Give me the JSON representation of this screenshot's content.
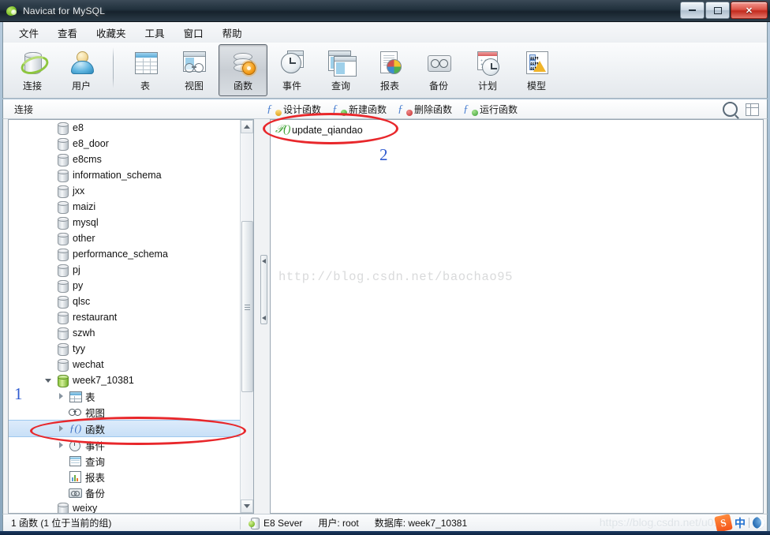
{
  "window": {
    "title": "Navicat for MySQL",
    "app_icon": "navicat-leaf-icon",
    "minimize_label": "—",
    "maximize_label": "❐",
    "close_label": "✕"
  },
  "menubar": {
    "items": [
      {
        "label": "文件",
        "name": "menu-file"
      },
      {
        "label": "查看",
        "name": "menu-view"
      },
      {
        "label": "收藏夹",
        "name": "menu-favorites"
      },
      {
        "label": "工具",
        "name": "menu-tools"
      },
      {
        "label": "窗口",
        "name": "menu-window"
      },
      {
        "label": "帮助",
        "name": "menu-help"
      }
    ]
  },
  "toolbar": {
    "items": [
      {
        "label": "连接",
        "icon": "connection-icon",
        "selected": false
      },
      {
        "label": "用户",
        "icon": "user-icon",
        "selected": false
      },
      {
        "label": "表",
        "icon": "table-icon",
        "selected": false
      },
      {
        "label": "视图",
        "icon": "view-icon",
        "selected": false
      },
      {
        "label": "函数",
        "icon": "function-icon",
        "selected": true
      },
      {
        "label": "事件",
        "icon": "event-icon",
        "selected": false
      },
      {
        "label": "查询",
        "icon": "query-icon",
        "selected": false
      },
      {
        "label": "报表",
        "icon": "report-icon",
        "selected": false
      },
      {
        "label": "备份",
        "icon": "backup-icon",
        "selected": false
      },
      {
        "label": "计划",
        "icon": "schedule-icon",
        "selected": false
      },
      {
        "label": "模型",
        "icon": "model-icon",
        "selected": false
      }
    ]
  },
  "subtoolbar": {
    "panel_title": "连接",
    "actions": [
      {
        "label": "设计函数",
        "icon": "design-function-icon"
      },
      {
        "label": "新建函数",
        "icon": "new-function-icon"
      },
      {
        "label": "删除函数",
        "icon": "delete-function-icon"
      },
      {
        "label": "运行函数",
        "icon": "run-function-icon"
      }
    ],
    "search_icon": "search-icon",
    "view_icon": "grid-view-icon"
  },
  "tree": {
    "items": [
      {
        "label": "e8",
        "icon": "database-icon",
        "level": 1,
        "expander": "none",
        "selected": false
      },
      {
        "label": "e8_door",
        "icon": "database-icon",
        "level": 1,
        "expander": "none",
        "selected": false
      },
      {
        "label": "e8cms",
        "icon": "database-icon",
        "level": 1,
        "expander": "none",
        "selected": false
      },
      {
        "label": "information_schema",
        "icon": "database-icon",
        "level": 1,
        "expander": "none",
        "selected": false
      },
      {
        "label": "jxx",
        "icon": "database-icon",
        "level": 1,
        "expander": "none",
        "selected": false
      },
      {
        "label": "maizi",
        "icon": "database-icon",
        "level": 1,
        "expander": "none",
        "selected": false
      },
      {
        "label": "mysql",
        "icon": "database-icon",
        "level": 1,
        "expander": "none",
        "selected": false
      },
      {
        "label": "other",
        "icon": "database-icon",
        "level": 1,
        "expander": "none",
        "selected": false
      },
      {
        "label": "performance_schema",
        "icon": "database-icon",
        "level": 1,
        "expander": "none",
        "selected": false
      },
      {
        "label": "pj",
        "icon": "database-icon",
        "level": 1,
        "expander": "none",
        "selected": false
      },
      {
        "label": "py",
        "icon": "database-icon",
        "level": 1,
        "expander": "none",
        "selected": false
      },
      {
        "label": "qlsc",
        "icon": "database-icon",
        "level": 1,
        "expander": "none",
        "selected": false
      },
      {
        "label": "restaurant",
        "icon": "database-icon",
        "level": 1,
        "expander": "none",
        "selected": false
      },
      {
        "label": "szwh",
        "icon": "database-icon",
        "level": 1,
        "expander": "none",
        "selected": false
      },
      {
        "label": "tyy",
        "icon": "database-icon",
        "level": 1,
        "expander": "none",
        "selected": false
      },
      {
        "label": "wechat",
        "icon": "database-icon",
        "level": 1,
        "expander": "none",
        "selected": false
      },
      {
        "label": "week7_10381",
        "icon": "database-open-icon",
        "level": 1,
        "expander": "open",
        "selected": false
      },
      {
        "label": "表",
        "icon": "table-node-icon",
        "level": 2,
        "expander": "closed",
        "selected": false
      },
      {
        "label": "视图",
        "icon": "view-node-icon",
        "level": 2,
        "expander": "none",
        "selected": false
      },
      {
        "label": "函数",
        "icon": "function-node-icon",
        "level": 2,
        "expander": "closed",
        "selected": true
      },
      {
        "label": "事件",
        "icon": "event-node-icon",
        "level": 2,
        "expander": "closed",
        "selected": false
      },
      {
        "label": "查询",
        "icon": "query-node-icon",
        "level": 2,
        "expander": "none",
        "selected": false
      },
      {
        "label": "报表",
        "icon": "report-node-icon",
        "level": 2,
        "expander": "none",
        "selected": false
      },
      {
        "label": "备份",
        "icon": "backup-node-icon",
        "level": 2,
        "expander": "none",
        "selected": false
      },
      {
        "label": "weixy",
        "icon": "database-icon",
        "level": 1,
        "expander": "none",
        "selected": false
      }
    ]
  },
  "main": {
    "functions": [
      {
        "name": "update_qiandao",
        "icon": "procedure-icon"
      }
    ],
    "watermark": "http://blog.csdn.net/baochao95"
  },
  "statusbar": {
    "count_text": "1 函数 (1 位于当前的组)",
    "server": "E8 Sever",
    "server_icon": "server-icon",
    "user": "用户: root",
    "database": "数据库: week7_10381"
  },
  "overlay": {
    "watermark": "https://blog.csdn.net/u01...",
    "ime_sogou": "S",
    "ime_mode": "中",
    "ime_moon": "moon-icon"
  },
  "annotations": [
    {
      "label": "1",
      "name": "annotation-number-1"
    },
    {
      "label": "2",
      "name": "annotation-number-2"
    }
  ],
  "colors": {
    "annotation_red": "#e8272b",
    "annotation_blue": "#2f5bd0",
    "selection_blue": "#c9e0f7"
  }
}
